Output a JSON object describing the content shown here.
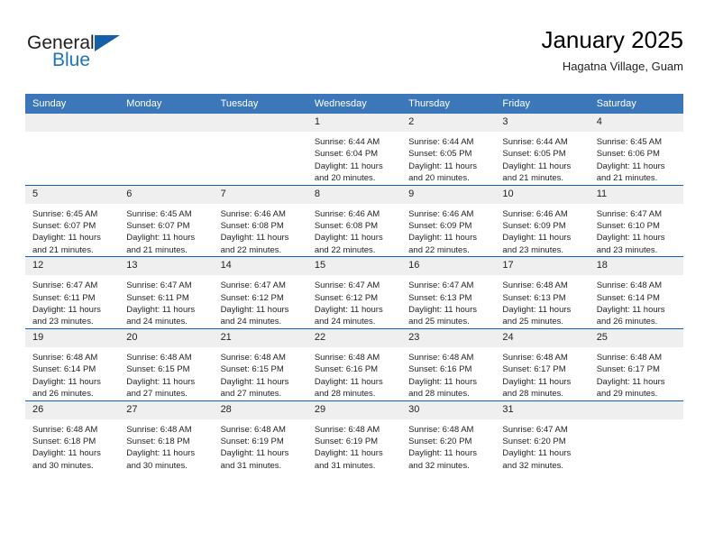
{
  "logo": {
    "word_one": "General",
    "word_two": "Blue",
    "triangle": "blue-triangle-icon"
  },
  "header": {
    "title": "January 2025",
    "subtitle": "Hagatna Village, Guam"
  },
  "colors": {
    "header_blue": "#3b77b9",
    "row_divider_blue": "#1560a8",
    "daynum_band": "#efefef",
    "logo_blue": "#1c75bc",
    "text": "#231f20"
  },
  "calendar": {
    "weekday_headers": [
      "Sunday",
      "Monday",
      "Tuesday",
      "Wednesday",
      "Thursday",
      "Friday",
      "Saturday"
    ],
    "weeks": [
      [
        {
          "day": "",
          "lines": []
        },
        {
          "day": "",
          "lines": []
        },
        {
          "day": "",
          "lines": []
        },
        {
          "day": "1",
          "lines": [
            "Sunrise: 6:44 AM",
            "Sunset: 6:04 PM",
            "Daylight: 11 hours",
            "and 20 minutes."
          ]
        },
        {
          "day": "2",
          "lines": [
            "Sunrise: 6:44 AM",
            "Sunset: 6:05 PM",
            "Daylight: 11 hours",
            "and 20 minutes."
          ]
        },
        {
          "day": "3",
          "lines": [
            "Sunrise: 6:44 AM",
            "Sunset: 6:05 PM",
            "Daylight: 11 hours",
            "and 21 minutes."
          ]
        },
        {
          "day": "4",
          "lines": [
            "Sunrise: 6:45 AM",
            "Sunset: 6:06 PM",
            "Daylight: 11 hours",
            "and 21 minutes."
          ]
        }
      ],
      [
        {
          "day": "5",
          "lines": [
            "Sunrise: 6:45 AM",
            "Sunset: 6:07 PM",
            "Daylight: 11 hours",
            "and 21 minutes."
          ]
        },
        {
          "day": "6",
          "lines": [
            "Sunrise: 6:45 AM",
            "Sunset: 6:07 PM",
            "Daylight: 11 hours",
            "and 21 minutes."
          ]
        },
        {
          "day": "7",
          "lines": [
            "Sunrise: 6:46 AM",
            "Sunset: 6:08 PM",
            "Daylight: 11 hours",
            "and 22 minutes."
          ]
        },
        {
          "day": "8",
          "lines": [
            "Sunrise: 6:46 AM",
            "Sunset: 6:08 PM",
            "Daylight: 11 hours",
            "and 22 minutes."
          ]
        },
        {
          "day": "9",
          "lines": [
            "Sunrise: 6:46 AM",
            "Sunset: 6:09 PM",
            "Daylight: 11 hours",
            "and 22 minutes."
          ]
        },
        {
          "day": "10",
          "lines": [
            "Sunrise: 6:46 AM",
            "Sunset: 6:09 PM",
            "Daylight: 11 hours",
            "and 23 minutes."
          ]
        },
        {
          "day": "11",
          "lines": [
            "Sunrise: 6:47 AM",
            "Sunset: 6:10 PM",
            "Daylight: 11 hours",
            "and 23 minutes."
          ]
        }
      ],
      [
        {
          "day": "12",
          "lines": [
            "Sunrise: 6:47 AM",
            "Sunset: 6:11 PM",
            "Daylight: 11 hours",
            "and 23 minutes."
          ]
        },
        {
          "day": "13",
          "lines": [
            "Sunrise: 6:47 AM",
            "Sunset: 6:11 PM",
            "Daylight: 11 hours",
            "and 24 minutes."
          ]
        },
        {
          "day": "14",
          "lines": [
            "Sunrise: 6:47 AM",
            "Sunset: 6:12 PM",
            "Daylight: 11 hours",
            "and 24 minutes."
          ]
        },
        {
          "day": "15",
          "lines": [
            "Sunrise: 6:47 AM",
            "Sunset: 6:12 PM",
            "Daylight: 11 hours",
            "and 24 minutes."
          ]
        },
        {
          "day": "16",
          "lines": [
            "Sunrise: 6:47 AM",
            "Sunset: 6:13 PM",
            "Daylight: 11 hours",
            "and 25 minutes."
          ]
        },
        {
          "day": "17",
          "lines": [
            "Sunrise: 6:48 AM",
            "Sunset: 6:13 PM",
            "Daylight: 11 hours",
            "and 25 minutes."
          ]
        },
        {
          "day": "18",
          "lines": [
            "Sunrise: 6:48 AM",
            "Sunset: 6:14 PM",
            "Daylight: 11 hours",
            "and 26 minutes."
          ]
        }
      ],
      [
        {
          "day": "19",
          "lines": [
            "Sunrise: 6:48 AM",
            "Sunset: 6:14 PM",
            "Daylight: 11 hours",
            "and 26 minutes."
          ]
        },
        {
          "day": "20",
          "lines": [
            "Sunrise: 6:48 AM",
            "Sunset: 6:15 PM",
            "Daylight: 11 hours",
            "and 27 minutes."
          ]
        },
        {
          "day": "21",
          "lines": [
            "Sunrise: 6:48 AM",
            "Sunset: 6:15 PM",
            "Daylight: 11 hours",
            "and 27 minutes."
          ]
        },
        {
          "day": "22",
          "lines": [
            "Sunrise: 6:48 AM",
            "Sunset: 6:16 PM",
            "Daylight: 11 hours",
            "and 28 minutes."
          ]
        },
        {
          "day": "23",
          "lines": [
            "Sunrise: 6:48 AM",
            "Sunset: 6:16 PM",
            "Daylight: 11 hours",
            "and 28 minutes."
          ]
        },
        {
          "day": "24",
          "lines": [
            "Sunrise: 6:48 AM",
            "Sunset: 6:17 PM",
            "Daylight: 11 hours",
            "and 28 minutes."
          ]
        },
        {
          "day": "25",
          "lines": [
            "Sunrise: 6:48 AM",
            "Sunset: 6:17 PM",
            "Daylight: 11 hours",
            "and 29 minutes."
          ]
        }
      ],
      [
        {
          "day": "26",
          "lines": [
            "Sunrise: 6:48 AM",
            "Sunset: 6:18 PM",
            "Daylight: 11 hours",
            "and 30 minutes."
          ]
        },
        {
          "day": "27",
          "lines": [
            "Sunrise: 6:48 AM",
            "Sunset: 6:18 PM",
            "Daylight: 11 hours",
            "and 30 minutes."
          ]
        },
        {
          "day": "28",
          "lines": [
            "Sunrise: 6:48 AM",
            "Sunset: 6:19 PM",
            "Daylight: 11 hours",
            "and 31 minutes."
          ]
        },
        {
          "day": "29",
          "lines": [
            "Sunrise: 6:48 AM",
            "Sunset: 6:19 PM",
            "Daylight: 11 hours",
            "and 31 minutes."
          ]
        },
        {
          "day": "30",
          "lines": [
            "Sunrise: 6:48 AM",
            "Sunset: 6:20 PM",
            "Daylight: 11 hours",
            "and 32 minutes."
          ]
        },
        {
          "day": "31",
          "lines": [
            "Sunrise: 6:47 AM",
            "Sunset: 6:20 PM",
            "Daylight: 11 hours",
            "and 32 minutes."
          ]
        },
        {
          "day": "",
          "lines": []
        }
      ]
    ]
  }
}
